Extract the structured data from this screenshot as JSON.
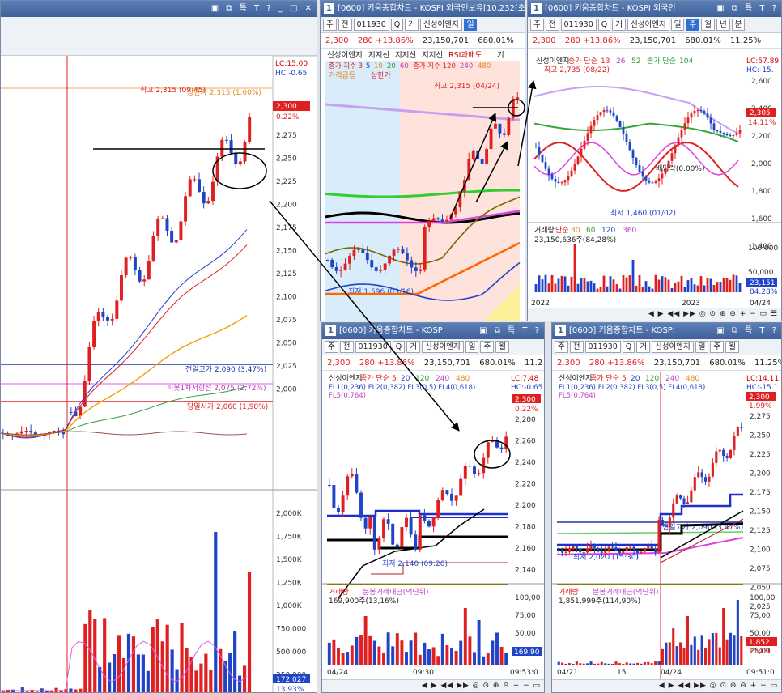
{
  "main_window": {
    "title_controls": "▣ ⧉ 특 T ? _ □ ✕",
    "lc": "LC:15.00",
    "hc": "HC:-0.65",
    "high_marker": "최고 2,315 (09:45)",
    "high_marker2": "상한가 2,315 (1.60%)",
    "current_price": "2,300",
    "current_change": "0.22%",
    "prev_high": "전일고가 2,090 (3,47%)",
    "pivot": "피봇1차저항선 2,075 (2,72%)",
    "open_price": "당일시가 2,060 (1,98%)",
    "price_ticks": [
      "2,275",
      "2,250",
      "2,225",
      "2,200",
      "2,175",
      "2,150",
      "2,125",
      "2,100",
      "2,075",
      "2,050",
      "2,025",
      "2,000"
    ],
    "volume_ticks": [
      "2,000K",
      "1,750K",
      "1,500K",
      "1,250K",
      "1,000K",
      "750,000",
      "500,000",
      "250,000"
    ],
    "volume_current": "172,027",
    "volume_pct": "13.93%"
  },
  "daily_window": {
    "title_num": "1",
    "title": "[0600] 키움종합차트 - KOSPI 외국인보유[10,232(초",
    "code": "011930",
    "toolbar": [
      "주",
      "전",
      "011930",
      "Q",
      "거",
      "신성이엔지",
      "일"
    ],
    "quote": {
      "price": "2,300",
      "change": "280 +13.86%",
      "volume": "23,150,701",
      "pct": "680.01%"
    },
    "indicator_tabs": [
      "신성이엔지",
      "지지선",
      "지지선",
      "지지선",
      "RSI과매도",
      "기"
    ],
    "legend": [
      "종가 지수 3",
      "5",
      "10",
      "20",
      "60",
      "종가 지수 120",
      "240",
      "480"
    ],
    "legend2": [
      "가격급등",
      "상한가"
    ],
    "high_marker": "최고 2,315 (04/24)",
    "low_marker": "최저 1,596 (03/16)"
  },
  "weekly_window": {
    "title_num": "1",
    "title": "[0600] 키움종합차트 - KOSPI 외국인",
    "code": "011930",
    "toolbar": [
      "주",
      "전",
      "011930",
      "Q",
      "거",
      "신성이엔지",
      "일",
      "주",
      "월",
      "년",
      "분"
    ],
    "quote": {
      "price": "2,300",
      "change": "280 +13.86%",
      "volume": "23,150,701",
      "pct": "680.01%",
      "extra": "11.25%"
    },
    "legend": [
      "신성이엔지",
      "종가 단순",
      "13",
      "26",
      "52",
      "종가 단순",
      "104"
    ],
    "lc": "LC:57.89",
    "hc": "HC:-15.",
    "high_marker": "최고 2,735 (08/22)",
    "low_marker": "최저 1,460 (01/02)",
    "dividend": "배당락(0.00%)",
    "current_price": "2,305",
    "current_pct": "14.11%",
    "price_ticks": [
      "2,600",
      "2,400",
      "2,200",
      "2,000",
      "1,800",
      "1,600",
      "1,400"
    ],
    "volume_legend": [
      "거래량",
      "단순",
      "30",
      "60",
      "120",
      "360"
    ],
    "volume_value": "23,150,636주(84,28%)",
    "volume_ticks": [
      "100,000",
      "50,000"
    ],
    "volume_current": "23,151",
    "volume_pct": "84.28%",
    "x_labels": [
      "2022",
      "2023",
      "04/24"
    ]
  },
  "minute_window": {
    "title_num": "1",
    "title": "[0600] 키움종합차트 - KOSP",
    "code": "011930",
    "toolbar": [
      "주",
      "전",
      "011930",
      "Q",
      "거",
      "신성이엔지",
      "일",
      "주",
      "월"
    ],
    "quote": {
      "price": "2,300",
      "change": "280 +13.86%",
      "volume": "23,150,701",
      "pct": "680.01%",
      "extra": "11.2"
    },
    "legend": [
      "신성이엔지",
      "종가 단순",
      "5",
      "20",
      "120",
      "240",
      "480"
    ],
    "fib": [
      "FL1(0,236)",
      "FL2(0,382)",
      "FL3(0,5)",
      "FL4(0,618)",
      "FL5(0,764)"
    ],
    "lc": "LC:7.48",
    "hc": "HC:-0.65",
    "current_price": "2,300",
    "current_change": "0.22%",
    "price_ticks": [
      "2,280",
      "2,260",
      "2,240",
      "2,220",
      "2,200",
      "2,180",
      "2,160",
      "2,140"
    ],
    "low_marker": "최저 2,140 (09:20)",
    "volume_legend": [
      "거래량",
      "분봉거래대금(억단위)"
    ],
    "volume_value": "169,900주(13,16%)",
    "volume_ticks": [
      "100,00",
      "75,00",
      "50,00",
      "25,00"
    ],
    "volume_current": "169,90",
    "x_labels": [
      "04/24",
      "09:30",
      "09:53:0"
    ]
  },
  "tenmin_window": {
    "title_num": "1",
    "title": "[0600] 키움종합차트 - KOSPI",
    "code": "011930",
    "toolbar": [
      "주",
      "전",
      "011930",
      "Q",
      "거",
      "신성이엔지",
      "일",
      "주",
      "월"
    ],
    "quote": {
      "price": "2,300",
      "change": "280 +13.86%",
      "volume": "23,150,701",
      "pct": "680.01%",
      "extra": "11.25%"
    },
    "legend": [
      "신성이엔지",
      "종가 단순",
      "5",
      "20",
      "120",
      "240",
      "480"
    ],
    "fib": [
      "FL1(0,236)",
      "FL2(0,382)",
      "FL3(0,5)",
      "FL4(0,618)",
      "FL5(0,764)"
    ],
    "lc": "LC:14.11",
    "hc": "HC:-15.1",
    "current_price": "2,300",
    "current_change": "1.99%",
    "price_ticks": [
      "2,275",
      "2,250",
      "2,225",
      "2,200",
      "2,175",
      "2,150",
      "2,125",
      "2,100",
      "2,075",
      "2,050",
      "2,025"
    ],
    "prev_high": "전일고가 2,090 (3,47%)",
    "low_marker": "최저 2,020 (15:30)",
    "volume_legend": [
      "거래량",
      "분봉거래대금(억단위)"
    ],
    "volume_value": "1,851,999주(114,90%)",
    "volume_ticks": [
      "100,00",
      "75,00",
      "50,00",
      "25,00"
    ],
    "volume_current": "1,852",
    "volume_pct": "114.9",
    "x_labels": [
      "04/21",
      "15",
      "04/24",
      "09:51:0"
    ]
  },
  "colors": {
    "up": "#e02020",
    "down": "#1f44c8",
    "title": "#3f6198"
  }
}
